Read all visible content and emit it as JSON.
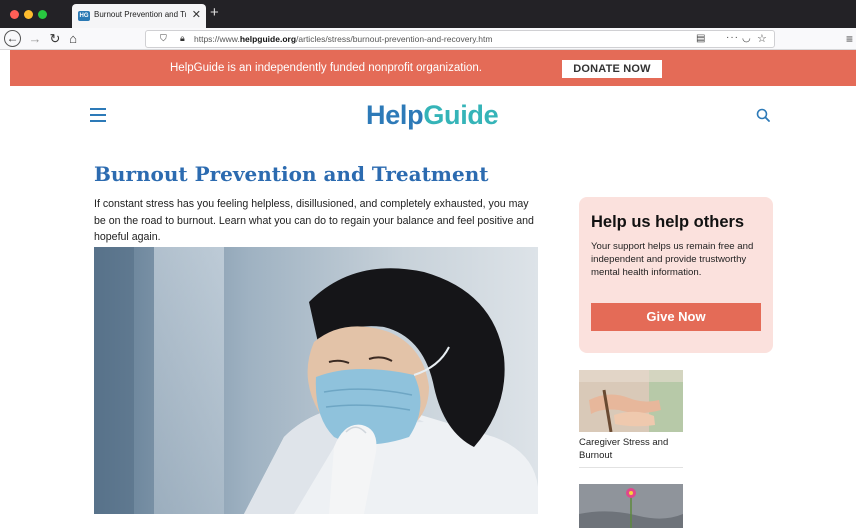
{
  "browser": {
    "tab_title": "Burnout Prevention and Treatm",
    "tab_favicon_text": "HG",
    "url_prefix": "https://www.",
    "url_domain": "helpguide.org",
    "url_path": "/articles/stress/burnout-prevention-and-recovery.htm",
    "icons": [
      "back-icon",
      "forward-icon",
      "reload-icon",
      "home-icon",
      "lock-icon",
      "reader-icon",
      "more-icon",
      "pocket-icon",
      "bookmark-star-icon",
      "menu-icon"
    ]
  },
  "banner": {
    "text": "HelpGuide is an independently funded nonprofit organization.",
    "donate_label": "DONATE NOW",
    "color": "#e46b57"
  },
  "site": {
    "logo_part1": "Help",
    "logo_part2": "Guide",
    "logo_color_1": "#2d7ab8",
    "logo_color_2": "#35b4b8"
  },
  "article": {
    "title": "Burnout Prevention and Treatment",
    "intro": "If constant stress has you feeling helpless, disillusioned, and completely exhausted, you may be on the road to burnout. Learn what you can do to regain your balance and feel positive and hopeful again."
  },
  "sidebar": {
    "card_title": "Help us help others",
    "card_body": "Your support helps us remain free and independent and provide trustworthy mental health information.",
    "give_label": "Give Now",
    "related": [
      {
        "title": "Caregiver Stress and Burnout"
      }
    ]
  }
}
